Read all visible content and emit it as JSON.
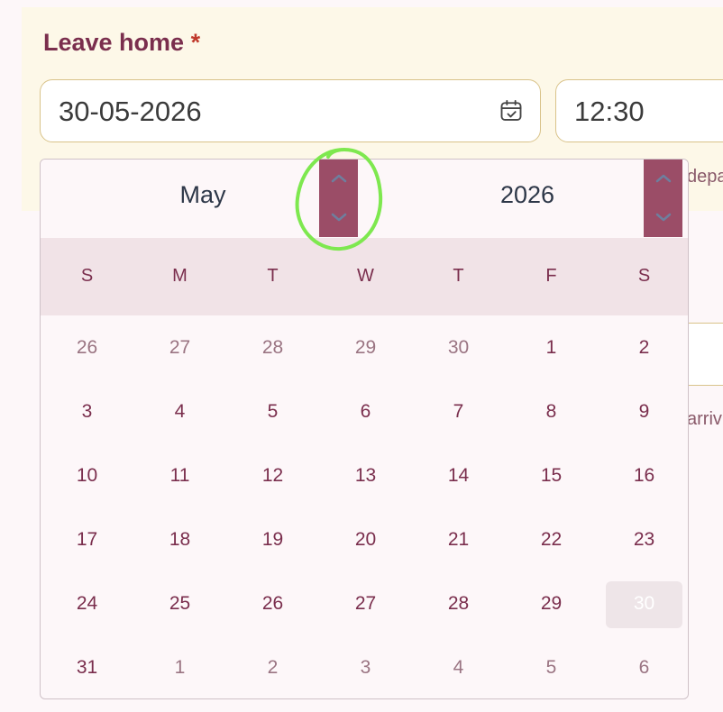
{
  "form": {
    "label": "Leave home",
    "required_mark": "*",
    "date_value": "30-05-2026",
    "time_value": "12:30",
    "hint_right_top": "depa",
    "hint_right_bottom": "arriv"
  },
  "picker": {
    "month": "May",
    "year": "2026",
    "weekdays": [
      "S",
      "M",
      "T",
      "W",
      "T",
      "F",
      "S"
    ],
    "weeks": [
      [
        "26",
        "27",
        "28",
        "29",
        "30",
        "1",
        "2"
      ],
      [
        "3",
        "4",
        "5",
        "6",
        "7",
        "8",
        "9"
      ],
      [
        "10",
        "11",
        "12",
        "13",
        "14",
        "15",
        "16"
      ],
      [
        "17",
        "18",
        "19",
        "20",
        "21",
        "22",
        "23"
      ],
      [
        "24",
        "25",
        "26",
        "27",
        "28",
        "29",
        "30"
      ],
      [
        "31",
        "1",
        "2",
        "3",
        "4",
        "5",
        "6"
      ]
    ],
    "selected_day": "30"
  },
  "colors": {
    "accent": "#7a2e4d",
    "spinner": "#9b4d67",
    "annotation": "#7ee84f"
  }
}
